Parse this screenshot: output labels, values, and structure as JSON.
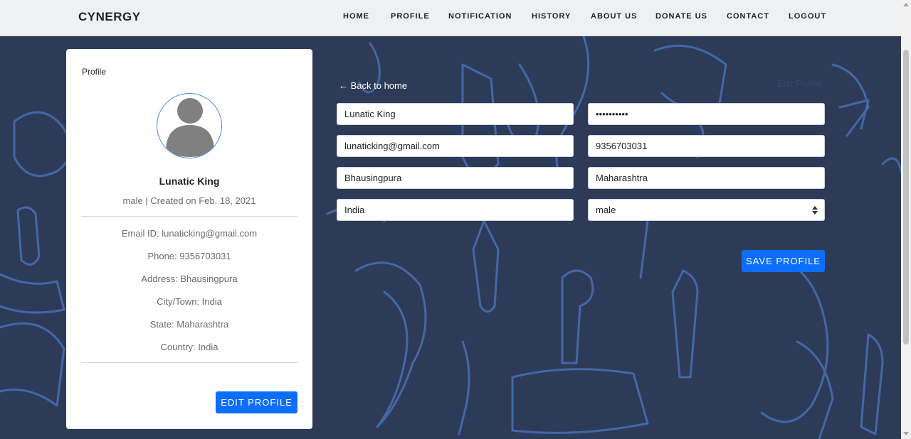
{
  "navbar": {
    "brand": "CYNERGY",
    "links": [
      "HOME",
      "PROFILE",
      "NOTIFICATION",
      "HISTORY",
      "ABOUT US",
      "DONATE US",
      "CONTACT",
      "LOGOUT"
    ]
  },
  "profile_card": {
    "title": "Profile",
    "name": "Lunatic King",
    "meta": "male | Created on Feb. 18, 2021",
    "details": [
      "Email ID: lunaticking@gmail.com",
      "Phone: 9356703031",
      "Address: Bhausingpura",
      "City/Town: India",
      "State: Maharashtra",
      "Country: India"
    ],
    "edit_button": "EDIT PROFILE"
  },
  "form": {
    "back_link": "← Back to home",
    "heading": "Edit Profile",
    "name_value": "Lunatic King",
    "password_value": "••••••••••",
    "email_value": "lunaticking@gmail.com",
    "phone_value": "9356703031",
    "address_value": "Bhausingpura",
    "state_value": "Maharashtra",
    "country_value": "India",
    "gender_selected": "male",
    "save_button": "SAVE PROFILE"
  },
  "colors": {
    "background": "#2e3b58",
    "primary_button": "#0d6efd",
    "sketch_lines": "#4a78c2"
  }
}
